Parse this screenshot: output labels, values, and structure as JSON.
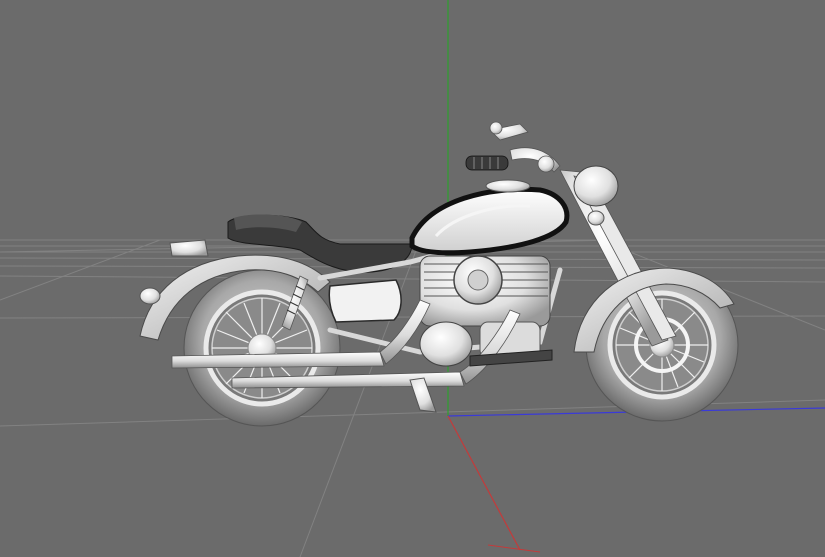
{
  "viewport": {
    "kind": "3d-viewport",
    "background_color": "#6b6b6b",
    "grid_color": "#8a8a8a",
    "axis_y_color": "#2fa02f",
    "axis_x_color": "#3a3ad8",
    "axis_z_color": "#c43a3a",
    "model": {
      "subject": "motorcycle",
      "shading": "gouraud-white"
    }
  }
}
